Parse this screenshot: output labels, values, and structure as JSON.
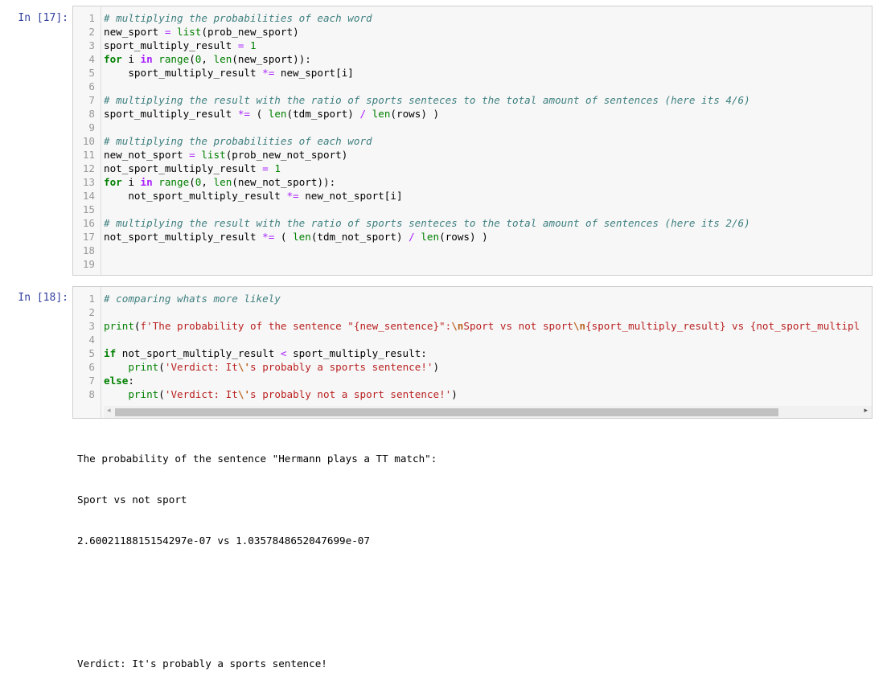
{
  "cells": [
    {
      "prompt": "In [17]:",
      "lines": [
        {
          "n": "1",
          "segs": [
            {
              "t": "# multiplying the probabilities of each word",
              "c": "#408080",
              "i": 1
            }
          ]
        },
        {
          "n": "2",
          "segs": [
            {
              "t": "new_sport ",
              "c": "#000000"
            },
            {
              "t": "=",
              "c": "#aa22ff"
            },
            {
              "t": " ",
              "c": "#000000"
            },
            {
              "t": "list",
              "c": "#008000"
            },
            {
              "t": "(prob_new_sport)",
              "c": "#000000"
            }
          ]
        },
        {
          "n": "3",
          "segs": [
            {
              "t": "sport_multiply_result ",
              "c": "#000000"
            },
            {
              "t": "=",
              "c": "#aa22ff"
            },
            {
              "t": " ",
              "c": "#000000"
            },
            {
              "t": "1",
              "c": "#008000"
            }
          ]
        },
        {
          "n": "4",
          "segs": [
            {
              "t": "for",
              "c": "#008000",
              "b": 1
            },
            {
              "t": " i ",
              "c": "#000000"
            },
            {
              "t": "in",
              "c": "#aa22ff",
              "b": 1
            },
            {
              "t": " ",
              "c": "#000000"
            },
            {
              "t": "range",
              "c": "#008000"
            },
            {
              "t": "(",
              "c": "#000000"
            },
            {
              "t": "0",
              "c": "#008000"
            },
            {
              "t": ", ",
              "c": "#000000"
            },
            {
              "t": "len",
              "c": "#008000"
            },
            {
              "t": "(new_sport)):",
              "c": "#000000"
            }
          ]
        },
        {
          "n": "5",
          "segs": [
            {
              "t": "    sport_multiply_result ",
              "c": "#000000"
            },
            {
              "t": "*=",
              "c": "#aa22ff"
            },
            {
              "t": " new_sport[i]",
              "c": "#000000"
            }
          ]
        },
        {
          "n": "6",
          "segs": []
        },
        {
          "n": "7",
          "segs": [
            {
              "t": "# multiplying the result with the ratio of sports senteces to the total amount of sentences (here its 4/6)",
              "c": "#408080",
              "i": 1
            }
          ]
        },
        {
          "n": "8",
          "segs": [
            {
              "t": "sport_multiply_result ",
              "c": "#000000"
            },
            {
              "t": "*=",
              "c": "#aa22ff"
            },
            {
              "t": " ( ",
              "c": "#000000"
            },
            {
              "t": "len",
              "c": "#008000"
            },
            {
              "t": "(tdm_sport) ",
              "c": "#000000"
            },
            {
              "t": "/",
              "c": "#aa22ff"
            },
            {
              "t": " ",
              "c": "#000000"
            },
            {
              "t": "len",
              "c": "#008000"
            },
            {
              "t": "(rows) )",
              "c": "#000000"
            }
          ]
        },
        {
          "n": "9",
          "segs": []
        },
        {
          "n": "10",
          "segs": [
            {
              "t": "# multiplying the probabilities of each word",
              "c": "#408080",
              "i": 1
            }
          ]
        },
        {
          "n": "11",
          "segs": [
            {
              "t": "new_not_sport ",
              "c": "#000000"
            },
            {
              "t": "=",
              "c": "#aa22ff"
            },
            {
              "t": " ",
              "c": "#000000"
            },
            {
              "t": "list",
              "c": "#008000"
            },
            {
              "t": "(prob_new_not_sport)",
              "c": "#000000"
            }
          ]
        },
        {
          "n": "12",
          "segs": [
            {
              "t": "not_sport_multiply_result ",
              "c": "#000000"
            },
            {
              "t": "=",
              "c": "#aa22ff"
            },
            {
              "t": " ",
              "c": "#000000"
            },
            {
              "t": "1",
              "c": "#008000"
            }
          ]
        },
        {
          "n": "13",
          "segs": [
            {
              "t": "for",
              "c": "#008000",
              "b": 1
            },
            {
              "t": " i ",
              "c": "#000000"
            },
            {
              "t": "in",
              "c": "#aa22ff",
              "b": 1
            },
            {
              "t": " ",
              "c": "#000000"
            },
            {
              "t": "range",
              "c": "#008000"
            },
            {
              "t": "(",
              "c": "#000000"
            },
            {
              "t": "0",
              "c": "#008000"
            },
            {
              "t": ", ",
              "c": "#000000"
            },
            {
              "t": "len",
              "c": "#008000"
            },
            {
              "t": "(new_not_sport)):",
              "c": "#000000"
            }
          ]
        },
        {
          "n": "14",
          "segs": [
            {
              "t": "    not_sport_multiply_result ",
              "c": "#000000"
            },
            {
              "t": "*=",
              "c": "#aa22ff"
            },
            {
              "t": " new_not_sport[i]",
              "c": "#000000"
            }
          ]
        },
        {
          "n": "15",
          "segs": []
        },
        {
          "n": "16",
          "segs": [
            {
              "t": "# multiplying the result with the ratio of sports senteces to the total amount of sentences (here its 2/6)",
              "c": "#408080",
              "i": 1
            }
          ]
        },
        {
          "n": "17",
          "segs": [
            {
              "t": "not_sport_multiply_result ",
              "c": "#000000"
            },
            {
              "t": "*=",
              "c": "#aa22ff"
            },
            {
              "t": " ( ",
              "c": "#000000"
            },
            {
              "t": "len",
              "c": "#008000"
            },
            {
              "t": "(tdm_not_sport) ",
              "c": "#000000"
            },
            {
              "t": "/",
              "c": "#aa22ff"
            },
            {
              "t": " ",
              "c": "#000000"
            },
            {
              "t": "len",
              "c": "#008000"
            },
            {
              "t": "(rows) )",
              "c": "#000000"
            }
          ]
        },
        {
          "n": "18",
          "segs": []
        },
        {
          "n": "19",
          "segs": []
        }
      ]
    },
    {
      "prompt": "In [18]:",
      "lines": [
        {
          "n": "1",
          "segs": [
            {
              "t": "# comparing whats more likely",
              "c": "#408080",
              "i": 1
            }
          ]
        },
        {
          "n": "2",
          "segs": []
        },
        {
          "n": "3",
          "segs": [
            {
              "t": "print",
              "c": "#008000"
            },
            {
              "t": "(",
              "c": "#000000"
            },
            {
              "t": "f'The probability of the sentence \"{new_sentence}\":",
              "c": "#ba2121"
            },
            {
              "t": "\\n",
              "c": "#bb6622",
              "b": 1
            },
            {
              "t": "Sport vs not sport",
              "c": "#ba2121"
            },
            {
              "t": "\\n",
              "c": "#bb6622",
              "b": 1
            },
            {
              "t": "{sport_multiply_result} vs {not_sport_multipl",
              "c": "#ba2121"
            }
          ]
        },
        {
          "n": "4",
          "segs": []
        },
        {
          "n": "5",
          "segs": [
            {
              "t": "if",
              "c": "#008000",
              "b": 1
            },
            {
              "t": " not_sport_multiply_result ",
              "c": "#000000"
            },
            {
              "t": "<",
              "c": "#aa22ff"
            },
            {
              "t": " sport_multiply_result:",
              "c": "#000000"
            }
          ]
        },
        {
          "n": "6",
          "segs": [
            {
              "t": "    ",
              "c": "#000000"
            },
            {
              "t": "print",
              "c": "#008000"
            },
            {
              "t": "(",
              "c": "#000000"
            },
            {
              "t": "'Verdict: It",
              "c": "#ba2121"
            },
            {
              "t": "\\'",
              "c": "#bb6622",
              "b": 1
            },
            {
              "t": "s probably a sports sentence!'",
              "c": "#ba2121"
            },
            {
              "t": ")",
              "c": "#000000"
            }
          ]
        },
        {
          "n": "7",
          "segs": [
            {
              "t": "else",
              "c": "#008000",
              "b": 1
            },
            {
              "t": ":",
              "c": "#000000"
            }
          ]
        },
        {
          "n": "8",
          "segs": [
            {
              "t": "    ",
              "c": "#000000"
            },
            {
              "t": "print",
              "c": "#008000"
            },
            {
              "t": "(",
              "c": "#000000"
            },
            {
              "t": "'Verdict: It",
              "c": "#ba2121"
            },
            {
              "t": "\\'",
              "c": "#bb6622",
              "b": 1
            },
            {
              "t": "s probably not a sport sentence!'",
              "c": "#ba2121"
            },
            {
              "t": ")",
              "c": "#000000"
            }
          ]
        }
      ]
    }
  ],
  "output": {
    "lines": [
      "The probability of the sentence \"Hermann plays a TT match\":",
      "Sport vs not sport",
      "2.6002118815154297e-07 vs 1.0357848652047699e-07",
      "",
      "",
      "Verdict: It's probably a sports sentence!"
    ]
  },
  "scrollbar": {
    "left_arrow": "◂",
    "right_arrow": "▸"
  }
}
